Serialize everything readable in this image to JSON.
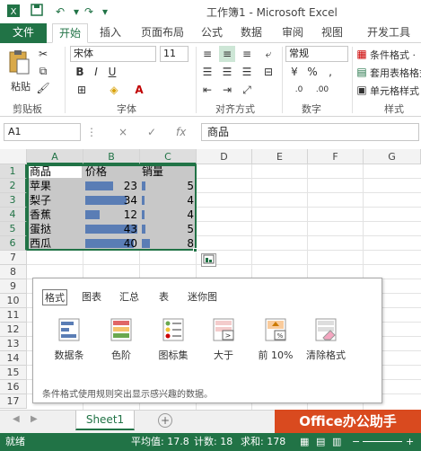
{
  "window": {
    "title": "工作簿1 - Microsoft Excel"
  },
  "ribbon_tabs": [
    "文件",
    "开始",
    "插入",
    "页面布局",
    "公式",
    "数据",
    "审阅",
    "视图",
    "开发工具"
  ],
  "ribbon": {
    "paste_label": "粘贴",
    "font_name": "宋体",
    "font_size": "11",
    "number_format": "常规",
    "conditional_format": "条件格式 ·",
    "table_format": "套用表格格式",
    "cell_styles": "单元格样式",
    "groups": {
      "clipboard": "剪贴板",
      "font": "字体",
      "alignment": "对齐方式",
      "number": "数字",
      "styles": "样式"
    }
  },
  "formula_bar": {
    "name_box": "A1",
    "cancel_icon": "×",
    "enter_icon": "✓",
    "fx_icon": "fx",
    "value": "商品"
  },
  "grid": {
    "columns": [
      "A",
      "B",
      "C",
      "D",
      "E",
      "F",
      "G"
    ],
    "rows": [
      "1",
      "2",
      "3",
      "4",
      "5",
      "6",
      "7",
      "8",
      "9",
      "10",
      "11",
      "12",
      "13",
      "14",
      "15",
      "16",
      "17"
    ],
    "headers": [
      "商品",
      "价格",
      "销量"
    ],
    "data": [
      {
        "name": "苹果",
        "price": "23",
        "qty": "5"
      },
      {
        "name": "梨子",
        "price": "34",
        "qty": "4"
      },
      {
        "name": "香蕉",
        "price": "12",
        "qty": "4"
      },
      {
        "name": "蛋挞",
        "price": "43",
        "qty": "5"
      },
      {
        "name": "西瓜",
        "price": "40",
        "qty": "8"
      }
    ],
    "databar_color": "#5a7db5"
  },
  "quick_analysis": {
    "tabs": [
      "格式",
      "图表",
      "汇总",
      "表",
      "迷你图"
    ],
    "active_tab": "格式",
    "items": [
      {
        "label": "数据条",
        "icon": "data-bars-icon"
      },
      {
        "label": "色阶",
        "icon": "color-scale-icon"
      },
      {
        "label": "图标集",
        "icon": "icon-set-icon"
      },
      {
        "label": "大于",
        "icon": "greater-than-icon"
      },
      {
        "label": "前 10%",
        "icon": "top-ten-percent-icon"
      },
      {
        "label": "清除格式",
        "icon": "clear-format-icon"
      }
    ],
    "description": "条件格式使用规则突出显示感兴趣的数据。"
  },
  "sheets": {
    "tabs": [
      "Sheet1"
    ],
    "add_icon": "+"
  },
  "watermark": "Office办公助手",
  "status": {
    "ready": "就绪",
    "average": "平均值: 17.8",
    "count": "计数: 18",
    "sum": "求和: 178"
  },
  "colors": {
    "accent": "#217346",
    "selection_fill": "#c8c8c8",
    "watermark_bg": "#d94a1f"
  }
}
